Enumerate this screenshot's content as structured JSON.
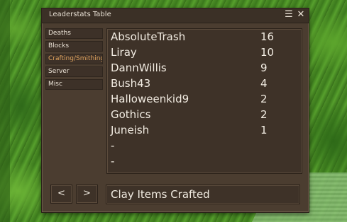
{
  "window": {
    "title": "Leaderstats Table"
  },
  "sidebar": {
    "items": [
      {
        "label": "Deaths"
      },
      {
        "label": "Blocks"
      },
      {
        "label": "Crafting/Smithing"
      },
      {
        "label": "Server"
      },
      {
        "label": "Misc"
      }
    ],
    "active_index": 2
  },
  "leaderboard": {
    "rows": [
      {
        "name": "AbsoluteTrash",
        "value": "16"
      },
      {
        "name": "Liray",
        "value": "10"
      },
      {
        "name": "DannWillis",
        "value": "9"
      },
      {
        "name": "Bush43",
        "value": "4"
      },
      {
        "name": "Halloweenkid9",
        "value": "2"
      },
      {
        "name": "Gothics",
        "value": "2"
      },
      {
        "name": "Juneish",
        "value": "1"
      },
      {
        "name": "-",
        "value": ""
      },
      {
        "name": "-",
        "value": ""
      }
    ]
  },
  "footer": {
    "prev_label": "<",
    "next_label": ">",
    "stat_label": "Clay Items Crafted"
  },
  "colors": {
    "panel_bg": "#4b3d30",
    "active_text": "#e0a45e",
    "text": "#f2ece2"
  }
}
